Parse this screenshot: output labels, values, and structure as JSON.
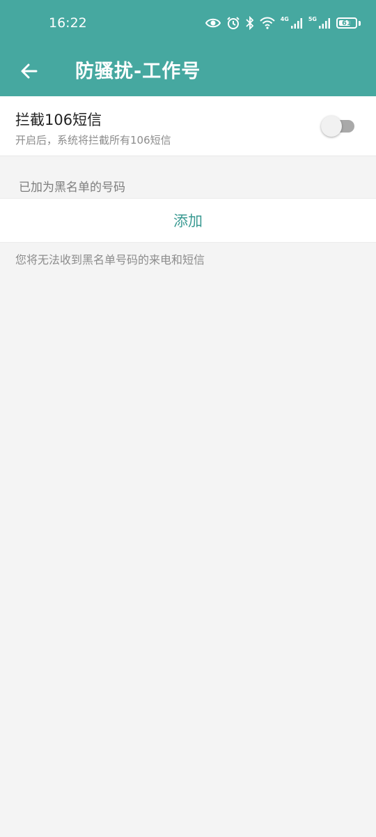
{
  "status_bar": {
    "time": "16:22",
    "net1_label": "4G",
    "net2_label": "5G",
    "battery_level": "61",
    "icons": [
      "eye-icon",
      "alarm-icon",
      "bluetooth-icon",
      "wifi-icon",
      "signal-icon",
      "signal-icon",
      "battery-icon"
    ]
  },
  "app_bar": {
    "title": "防骚扰-工作号",
    "back_icon": "arrow-left-icon",
    "background_color": "#46a8a0"
  },
  "block_sms": {
    "title": "拦截106短信",
    "subtitle": "开启后，系统将拦截所有106短信",
    "toggle_on": false
  },
  "blacklist": {
    "section_title": "已加为黑名单的号码",
    "add_label": "添加",
    "accent_color": "#3a9a92",
    "footnote": "您将无法收到黑名单号码的来电和短信"
  }
}
